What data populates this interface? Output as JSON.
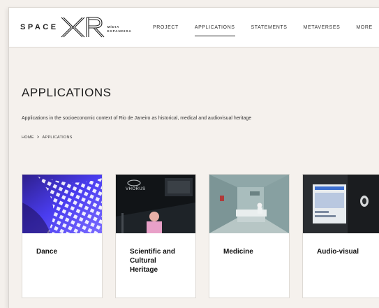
{
  "header": {
    "logo": {
      "word": "SPACE",
      "mark": "XR",
      "sub_line1": "MÍDIA",
      "sub_line2": "EXPANDIDA"
    },
    "nav": [
      {
        "label": "PROJECT",
        "active": false
      },
      {
        "label": "APPLICATIONS",
        "active": true
      },
      {
        "label": "STATEMENTS",
        "active": false
      },
      {
        "label": "METAVERSES",
        "active": false
      },
      {
        "label": "MORE",
        "active": false
      }
    ]
  },
  "main": {
    "title": "APPLICATIONS",
    "subtitle": "Applications in the socioeconomic context of Rio de Janeiro as historical, medical and audiovisual heritage",
    "breadcrumb": {
      "home": "HOME",
      "separator": ">",
      "current": "APPLICATIONS"
    },
    "cards": [
      {
        "label": "Dance",
        "image_overlay": ""
      },
      {
        "label": "Scientific and Cultural Heritage",
        "image_overlay": "VHORUS"
      },
      {
        "label": "Medicine",
        "image_overlay": ""
      },
      {
        "label": "Audio-visual",
        "image_overlay": ""
      }
    ]
  },
  "colors": {
    "background": "#f5f1ed",
    "header_bg": "#ffffff",
    "text": "#1b1b1b",
    "dance_purple": "#4a3df0"
  }
}
